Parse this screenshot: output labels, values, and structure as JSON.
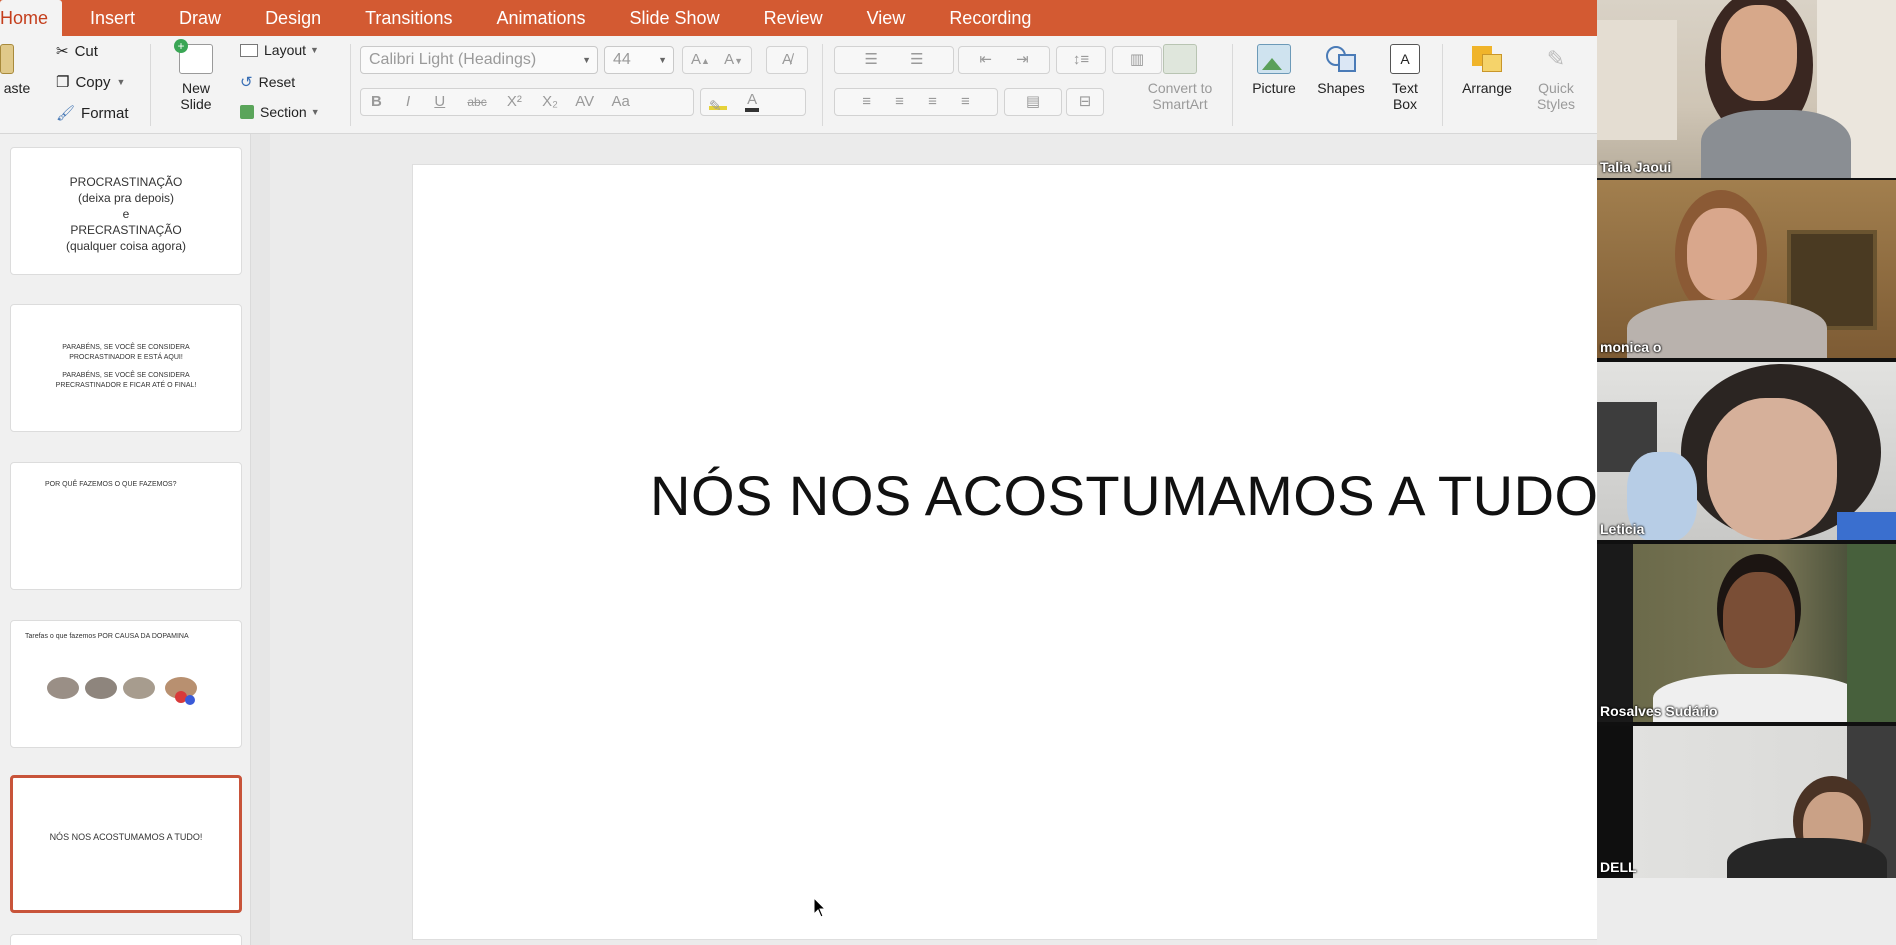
{
  "ribbon": {
    "tabs": [
      {
        "label": "Home",
        "active": true
      },
      {
        "label": "Insert"
      },
      {
        "label": "Draw"
      },
      {
        "label": "Design"
      },
      {
        "label": "Transitions"
      },
      {
        "label": "Animations"
      },
      {
        "label": "Slide Show"
      },
      {
        "label": "Review"
      },
      {
        "label": "View"
      },
      {
        "label": "Recording"
      }
    ],
    "clipboard": {
      "paste": "aste",
      "cut": "Cut",
      "copy": "Copy",
      "format": "Format"
    },
    "slides": {
      "new_slide_line1": "New",
      "new_slide_line2": "Slide",
      "layout": "Layout",
      "reset": "Reset",
      "section": "Section"
    },
    "font": {
      "name": "Calibri Light (Headings)",
      "size": "44"
    },
    "drawing": {
      "convert_line1": "Convert to",
      "convert_line2": "SmartArt",
      "picture": "Picture",
      "shapes": "Shapes",
      "textbox_line1": "Text",
      "textbox_line2": "Box",
      "arrange": "Arrange",
      "quick_line1": "Quick",
      "quick_line2": "Styles"
    }
  },
  "thumbnails": [
    {
      "lines": [
        "PROCRASTINAÇÃO",
        "(deixa pra depois)",
        "e",
        "PRECRASTINAÇÃO",
        "(qualquer coisa agora)"
      ]
    },
    {
      "lines": [
        "PARABÉNS, SE VOCÊ SE CONSIDERA",
        "PROCRASTINADOR E ESTÁ AQUI!",
        "PARABÉNS, SE VOCÊ SE CONSIDERA",
        "PRECRASTINADOR E FICAR ATÉ O FINAL!"
      ]
    },
    {
      "lines": [
        "POR QUÊ FAZEMOS O QUE FAZEMOS?"
      ]
    },
    {
      "lines": [
        "Tarefas o que fazemos POR CAUSA DA DOPAMINA"
      ]
    },
    {
      "lines": [
        "NÓS NOS ACOSTUMAMOS A TUDO!"
      ],
      "selected": true
    }
  ],
  "slide": {
    "title": "NÓS NOS ACOSTUMAMOS A TUDO!"
  },
  "participants": [
    {
      "name": "Talia Jaoui"
    },
    {
      "name": "monica o"
    },
    {
      "name": "Leticia"
    },
    {
      "name": "Rosalves Sudário"
    },
    {
      "name": "DELL"
    }
  ],
  "colors": {
    "accent": "#d35a32",
    "selected_border": "#c8543a"
  }
}
